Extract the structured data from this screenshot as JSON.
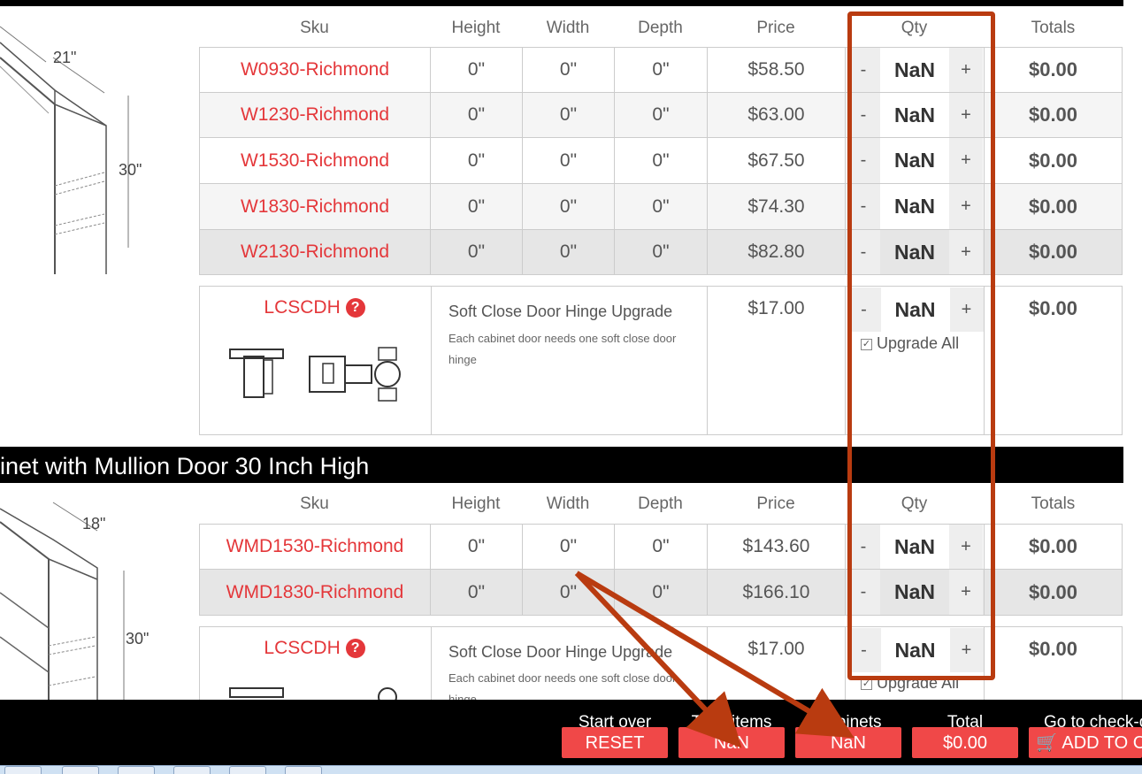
{
  "section1": {
    "headers": [
      "Sku",
      "Height",
      "Width",
      "Depth",
      "Price",
      "Qty",
      "Totals"
    ],
    "dims": {
      "w": "21\"",
      "h": "30\""
    },
    "rows": [
      {
        "sku": "W0930-Richmond",
        "height": "0\"",
        "width": "0\"",
        "depth": "0\"",
        "price": "$58.50",
        "qty": "NaN",
        "total": "$0.00"
      },
      {
        "sku": "W1230-Richmond",
        "height": "0\"",
        "width": "0\"",
        "depth": "0\"",
        "price": "$63.00",
        "qty": "NaN",
        "total": "$0.00"
      },
      {
        "sku": "W1530-Richmond",
        "height": "0\"",
        "width": "0\"",
        "depth": "0\"",
        "price": "$67.50",
        "qty": "NaN",
        "total": "$0.00"
      },
      {
        "sku": "W1830-Richmond",
        "height": "0\"",
        "width": "0\"",
        "depth": "0\"",
        "price": "$74.30",
        "qty": "NaN",
        "total": "$0.00"
      },
      {
        "sku": "W2130-Richmond",
        "height": "0\"",
        "width": "0\"",
        "depth": "0\"",
        "price": "$82.80",
        "qty": "NaN",
        "total": "$0.00"
      }
    ],
    "upgrade": {
      "sku": "LCSCDH",
      "title": "Soft Close Door Hinge Upgrade",
      "desc": "Each cabinet door needs one soft close door hinge",
      "price": "$17.00",
      "qty": "NaN",
      "total": "$0.00",
      "upgrade_all": "Upgrade All"
    }
  },
  "section2": {
    "title": "inet with Mullion Door 30 Inch High",
    "headers": [
      "Sku",
      "Height",
      "Width",
      "Depth",
      "Price",
      "Qty",
      "Totals"
    ],
    "dims": {
      "w": "18\"",
      "h": "30\""
    },
    "rows": [
      {
        "sku": "WMD1530-Richmond",
        "height": "0\"",
        "width": "0\"",
        "depth": "0\"",
        "price": "$143.60",
        "qty": "NaN",
        "total": "$0.00"
      },
      {
        "sku": "WMD1830-Richmond",
        "height": "0\"",
        "width": "0\"",
        "depth": "0\"",
        "price": "$166.10",
        "qty": "NaN",
        "total": "$0.00"
      }
    ],
    "upgrade": {
      "sku": "LCSCDH",
      "title": "Soft Close Door Hinge Upgrade",
      "desc": "Each cabinet door needs one soft close door hinge",
      "price": "$17.00",
      "qty": "NaN",
      "total": "$0.00",
      "upgrade_all": "Upgrade All"
    }
  },
  "qty_minus": "-",
  "qty_plus": "+",
  "footer": {
    "start_over_label": "Start over",
    "reset_button": "RESET",
    "total_items_label": "Total items",
    "total_items_value": "NaN",
    "cabinets_label": "Cabinets",
    "cabinets_value": "NaN",
    "total_label": "Total",
    "total_value": "$0.00",
    "checkout_label": "Go to check-o",
    "add_to_cart": "ADD TO CA"
  },
  "colors": {
    "accent": "#e4373a",
    "annotation": "#b93b10",
    "button": "#f04848"
  }
}
